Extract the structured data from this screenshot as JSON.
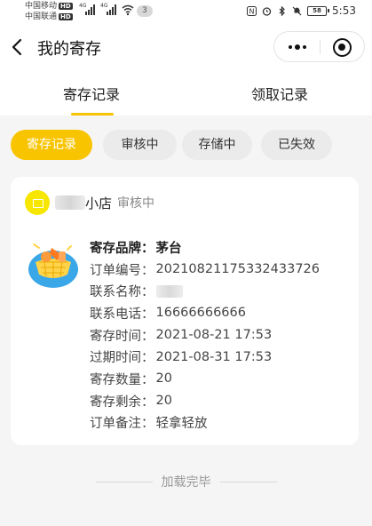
{
  "status_bar": {
    "carrier_1": "中国移动",
    "carrier_2": "中国联通",
    "hd_tag": "HD",
    "net_tag": "4G",
    "notification_count": "3",
    "battery_level": "58",
    "time": "5:53"
  },
  "nav": {
    "title": "我的寄存"
  },
  "tabs": [
    {
      "label": "寄存记录",
      "active": true
    },
    {
      "label": "领取记录",
      "active": false
    }
  ],
  "filters": [
    {
      "label": "寄存记录",
      "active": true
    },
    {
      "label": "审核中",
      "active": false
    },
    {
      "label": "存储中",
      "active": false
    },
    {
      "label": "已失效",
      "active": false
    }
  ],
  "record": {
    "shop_name_suffix": "小店",
    "shop_status": "审核中",
    "fields": [
      {
        "label": "寄存品牌：",
        "value": "茅台"
      },
      {
        "label": "订单编号：",
        "value": "20210821175332433726"
      },
      {
        "label": "联系名称：",
        "value": ""
      },
      {
        "label": "联系电话：",
        "value": "16666666666"
      },
      {
        "label": "寄存时间：",
        "value": "2021-08-21 17:53"
      },
      {
        "label": "过期时间：",
        "value": "2021-08-31 17:53"
      },
      {
        "label": "寄存数量：",
        "value": "20"
      },
      {
        "label": "寄存剩余：",
        "value": "20"
      },
      {
        "label": "订单备注：",
        "value": "轻拿轻放"
      }
    ]
  },
  "footer": {
    "text": "加载完毕"
  },
  "colors": {
    "accent": "#f8c400",
    "background": "#f5f5f5",
    "card": "#ffffff",
    "muted_text": "#888888"
  },
  "icons": {
    "back": "chevron-left-icon",
    "more": "more-dots-icon",
    "close": "target-close-icon",
    "shop": "shop-avatar-icon",
    "product": "basket-icon"
  }
}
